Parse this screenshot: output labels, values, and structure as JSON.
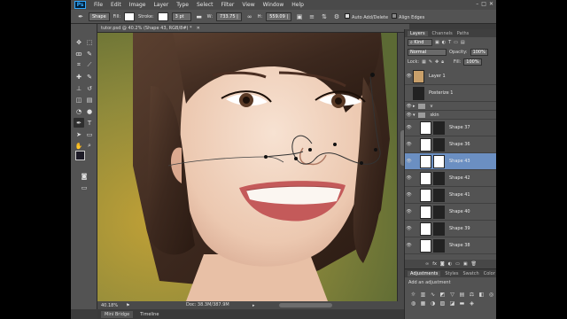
{
  "menu": [
    "File",
    "Edit",
    "Image",
    "Layer",
    "Type",
    "Select",
    "Filter",
    "View",
    "Window",
    "Help"
  ],
  "logo": "Ps",
  "options": {
    "tool_mode": "Shape",
    "fill_label": "Fill:",
    "stroke_label": "Stroke:",
    "stroke_width": "3 pt",
    "w_label": "W:",
    "w_value": "733.75 |",
    "h_label": "H:",
    "h_value": "559.09 |",
    "auto_add_delete": "Auto Add/Delete",
    "align_edges": "Align Edges"
  },
  "document": {
    "tab_label": "tutor.psd @ 40.2% (Shape 43, RGB/8#) *",
    "zoom": "40.18%",
    "doc_size": "Doc: 38.3M/387.9M"
  },
  "bottom_tabs": [
    "Mini Bridge",
    "Timeline"
  ],
  "layers_panel": {
    "tabs": [
      "Layers",
      "Channels",
      "Paths"
    ],
    "kind_label": "Kind",
    "blend_mode": "Normal",
    "opacity_label": "Opacity:",
    "opacity": "100%",
    "lock_label": "Lock:",
    "fill_label": "Fill:",
    "fill": "100%",
    "layers": [
      {
        "name": "Layer 1",
        "thumb": "photo"
      },
      {
        "name": "Posterize 1",
        "thumb": "dark"
      },
      {
        "name": "v",
        "thumb": "folder"
      },
      {
        "name": "skin",
        "thumb": "folder"
      },
      {
        "name": "Shape 37",
        "thumb": "white"
      },
      {
        "name": "Shape 36",
        "thumb": "white"
      },
      {
        "name": "Shape 43",
        "thumb": "white",
        "selected": true
      },
      {
        "name": "Shape 42",
        "thumb": "white"
      },
      {
        "name": "Shape 41",
        "thumb": "white"
      },
      {
        "name": "Shape 40",
        "thumb": "white"
      },
      {
        "name": "Shape 39",
        "thumb": "white"
      },
      {
        "name": "Shape 38",
        "thumb": "white"
      }
    ]
  },
  "adjustments_panel": {
    "tabs": [
      "Adjustments",
      "Styles",
      "Swatch",
      "Color"
    ],
    "add_label": "Add an adjustment"
  },
  "colors": {
    "selected_layer": "#6b8fc2",
    "ui_dark": "#3c3c3c",
    "ui_panel": "#535353"
  }
}
